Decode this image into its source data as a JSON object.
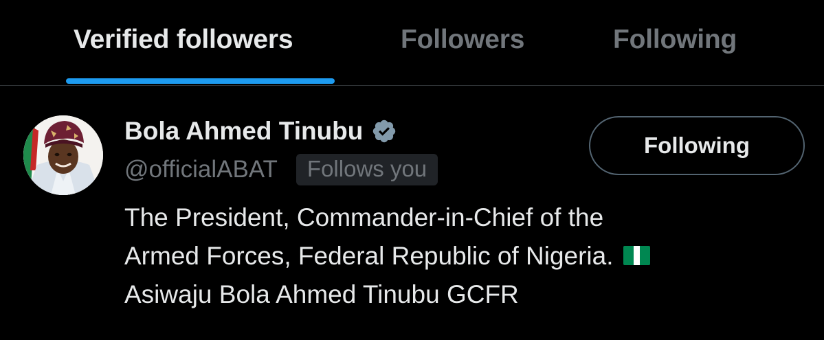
{
  "tabs": [
    {
      "label": "Verified followers",
      "active": true
    },
    {
      "label": "Followers",
      "active": false
    },
    {
      "label": "Following",
      "active": false
    }
  ],
  "user": {
    "display_name": "Bola Ahmed Tinubu",
    "verified": true,
    "handle": "@officialABAT",
    "follows_you_label": "Follows you",
    "follow_button_label": "Following",
    "bio_lines": [
      "The President, Commander-in-Chief of the",
      "Armed Forces, Federal Republic of Nigeria.",
      "Asiwaju Bola Ahmed Tinubu GCFR"
    ],
    "bio_emoji": "nigeria-flag-icon"
  },
  "colors": {
    "background": "#000000",
    "primary_text": "#e7e9ea",
    "secondary_text": "#71767b",
    "accent": "#1d9bf0",
    "divider": "#2f3336",
    "verified_badge": "#829aab",
    "badge_background": "#202327"
  },
  "icons": {
    "verified": "verified-badge-icon",
    "avatar": "user-avatar"
  }
}
